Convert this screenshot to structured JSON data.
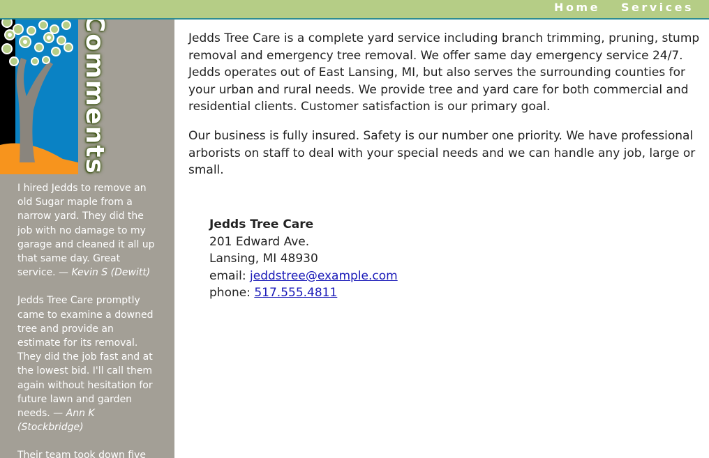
{
  "nav": {
    "home": "Home",
    "services": "Services"
  },
  "sidebar": {
    "title": "Comments",
    "testimonials": [
      {
        "text": "I hired Jedds to remove an old Sugar maple from a narrow yard. They did the job with no damage to my garage and cleaned it all up that same day. Great service. — ",
        "author": "Kevin S (Dewitt)"
      },
      {
        "text": "Jedds Tree Care promptly came to examine a downed tree and provide an estimate for its removal. They did the job fast and at the lowest bid. I'll call them again without hesitation for future lawn and garden needs. — ",
        "author": "Ann K (Stockbridge)"
      },
      {
        "text": "Their team took down five",
        "author": ""
      }
    ]
  },
  "main": {
    "paragraphs": [
      "Jedds Tree Care is a complete yard service including branch trimming, pruning, stump removal and emergency tree removal. We offer same day emergency service 24/7. Jedds operates out of East Lansing, MI, but also serves the surrounding counties for your urban and rural needs. We provide tree and yard care for both commercial and residential clients. Customer satisfaction is our primary goal.",
      "Our business is fully insured. Safety is our number one priority. We have professional arborists on staff to deal with your special needs and we can handle any job, large or small."
    ]
  },
  "address": {
    "name": "Jedds Tree Care",
    "street": "201 Edward Ave.",
    "city": "Lansing, MI 48930",
    "email_label": "email: ",
    "email": "jeddstree@example.com",
    "phone_label": "phone: ",
    "phone": "517.555.4811"
  },
  "colors": {
    "topbar": "#b5cd86",
    "sidebar": "#a39f96",
    "logo_blue": "#0a82c4",
    "logo_orange": "#f7941d",
    "link": "#1a1ab8"
  }
}
